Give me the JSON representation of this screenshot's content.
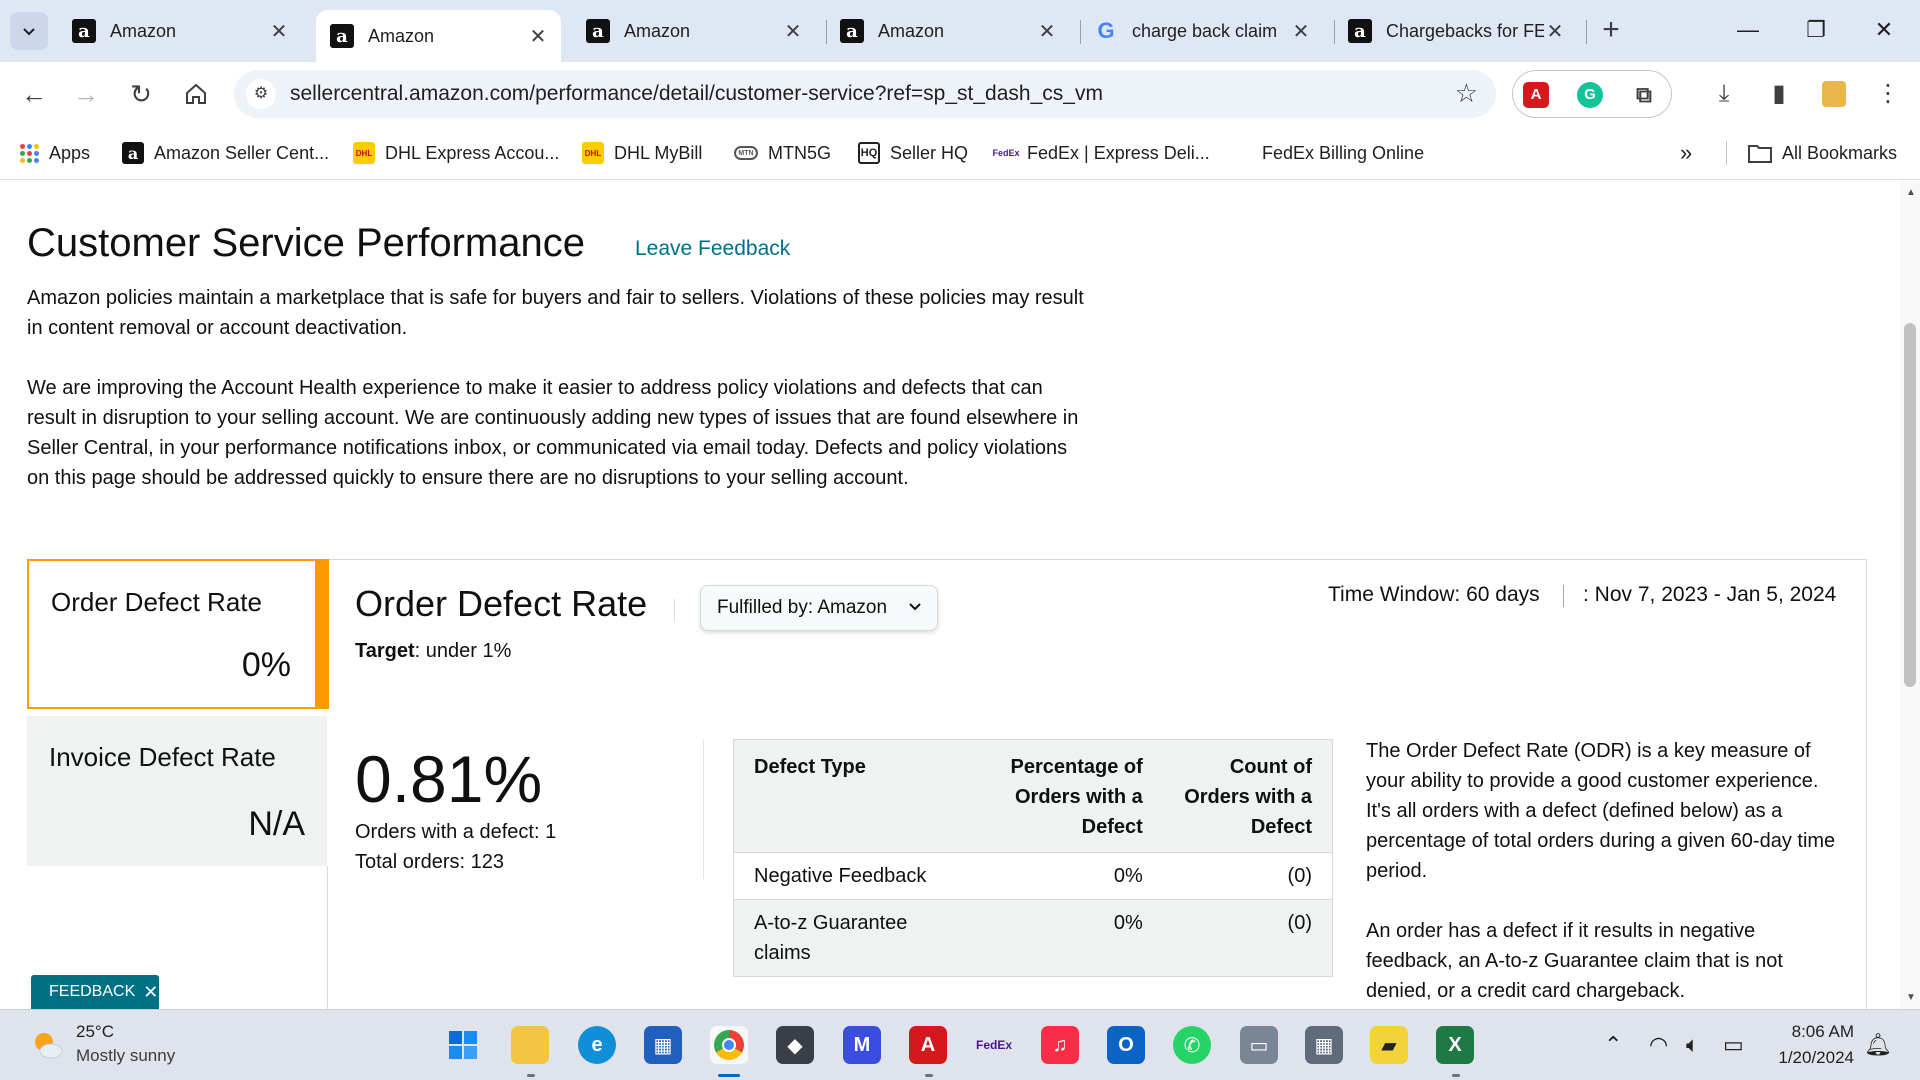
{
  "browser": {
    "tabs": [
      {
        "title": "Amazon",
        "icon": "amazon-icon"
      },
      {
        "title": "Amazon",
        "icon": "amazon-icon",
        "active": true
      },
      {
        "title": "Amazon",
        "icon": "amazon-icon"
      },
      {
        "title": "Amazon",
        "icon": "amazon-icon"
      },
      {
        "title": "charge back claim",
        "icon": "google-icon"
      },
      {
        "title": "Chargebacks for FE",
        "icon": "amazon-icon"
      }
    ],
    "url": "sellercentral.amazon.com/performance/detail/customer-service?ref=sp_st_dash_cs_vm",
    "bookmarks": [
      {
        "label": "Apps"
      },
      {
        "label": "Amazon Seller Cent..."
      },
      {
        "label": "DHL Express Accou..."
      },
      {
        "label": "DHL MyBill"
      },
      {
        "label": "MTN5G"
      },
      {
        "label": "Seller HQ"
      },
      {
        "label": "FedEx | Express Deli..."
      },
      {
        "label": "FedEx Billing Online"
      }
    ],
    "all_bookmarks": "All Bookmarks",
    "overflow": "»"
  },
  "page": {
    "title": "Customer Service Performance",
    "leave_feedback": "Leave Feedback",
    "para1": "Amazon policies maintain a marketplace that is safe for buyers and fair to sellers. Violations of these policies may result in content removal or account deactivation.",
    "para2": "We are improving the Account Health experience to make it easier to address policy violations and defects that can result in disruption to your selling account. We are continuously adding new types of issues that are found elsewhere in Seller Central, in your performance notifications inbox, or communicated via email today. Defects and policy violations on this page should be addressed quickly to ensure there are no disruptions to your selling account.",
    "metrics": [
      {
        "title": "Order Defect Rate",
        "value": "0%"
      },
      {
        "title": "Invoice Defect Rate",
        "value": "N/A"
      }
    ],
    "odr": {
      "title": "Order Defect Rate",
      "fulfilled_by": "Fulfilled by: Amazon",
      "target_label": "Target",
      "target_value": ": under 1%",
      "time_window": "Time Window: 60 days",
      "date_range": ": Nov 7, 2023 - Jan 5, 2024",
      "rate": "0.81%",
      "orders_with_defect": "Orders with a defect: 1",
      "total_orders": "Total orders: 123"
    },
    "table": {
      "headers": [
        "Defect Type",
        "Percentage of Orders with a Defect",
        "Count of Orders with a Defect"
      ],
      "rows": [
        {
          "type": "Negative Feedback",
          "pct": "0%",
          "count": "(0)"
        },
        {
          "type": "A-to-z Guarantee claims",
          "pct": "0%",
          "count": "(0)"
        }
      ]
    },
    "explain1": "The Order Defect Rate (ODR) is a key measure of your ability to provide a good customer experience. It's all orders with a defect (defined below) as a percentage of total orders during a given 60-day time period.",
    "explain2": "An order has a defect if it results in negative feedback, an A-to-z Guarantee claim that is not denied, or a credit card chargeback.",
    "feedback_tab": "FEEDBACK"
  },
  "taskbar": {
    "temp": "25°C",
    "weather": "Mostly sunny",
    "time": "8:06 AM",
    "date": "1/20/2024"
  },
  "colors": {
    "accent_orange": "#ff9900",
    "link_teal": "#007185",
    "chrome_tabstrip": "#dfe6f4"
  }
}
